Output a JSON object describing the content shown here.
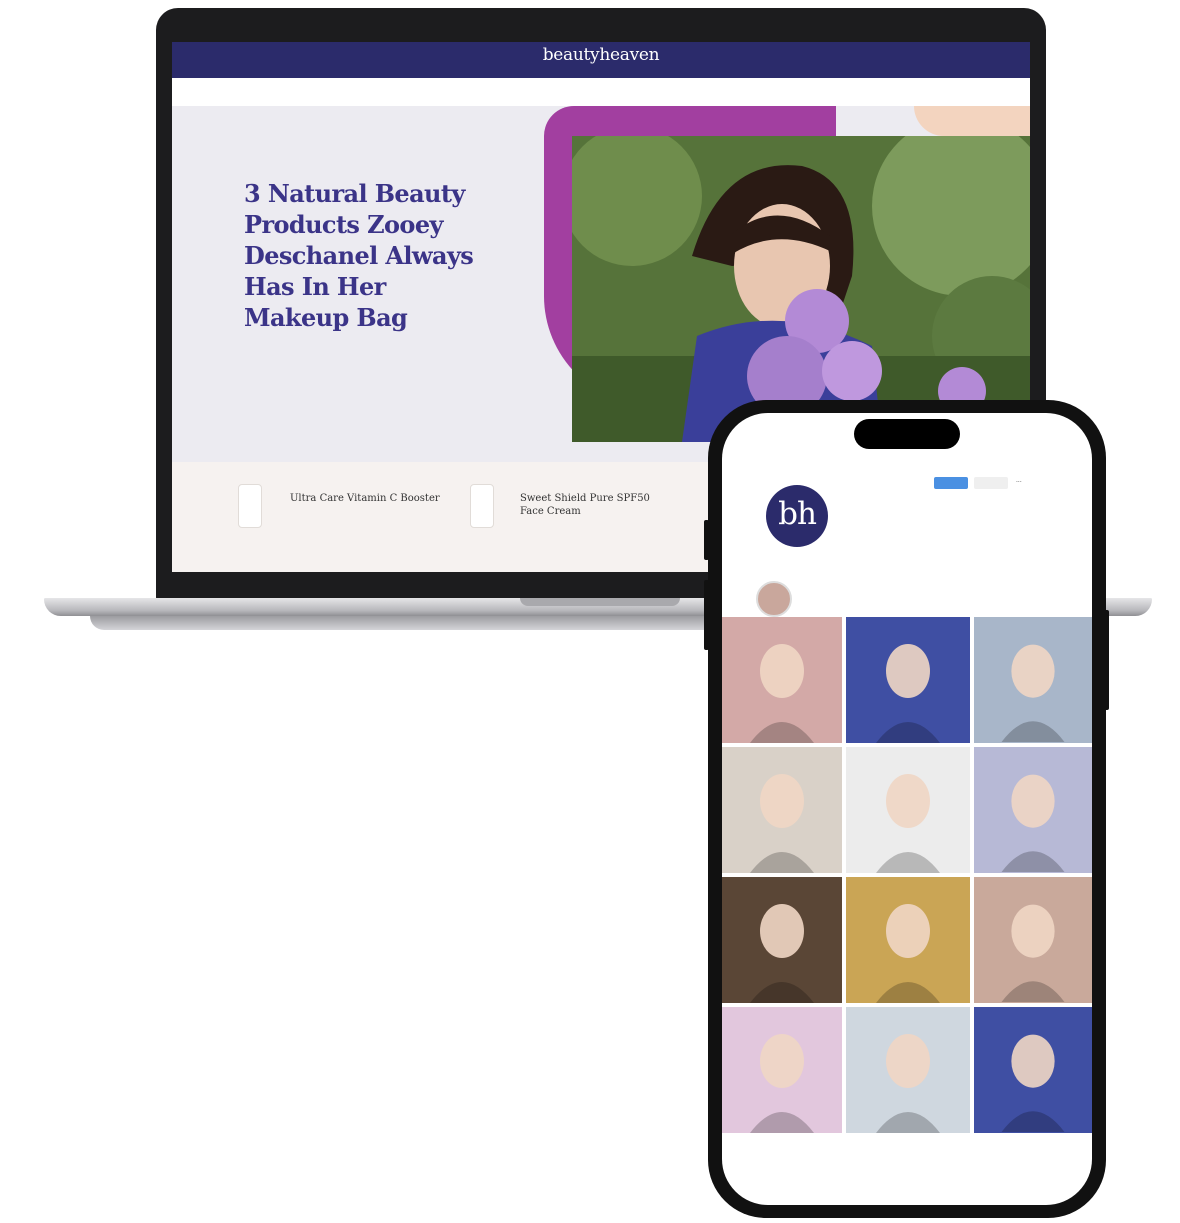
{
  "laptop": {
    "site": {
      "logo": "beautyheaven",
      "header_links": [
        "",
        "",
        ""
      ],
      "nav_items": [
        "",
        "",
        "",
        "",
        "",
        "",
        "",
        "",
        ""
      ]
    },
    "article": {
      "title": "3 Natural Beauty Products Zooey Deschanel Always Has In Her Makeup Bag",
      "byline": "",
      "summary": ""
    },
    "products": [
      {
        "category": "",
        "name": "Ultra Care Vitamin C Booster"
      },
      {
        "category": "",
        "name": "Sweet Shield Pure SPF50 Face Cream"
      }
    ]
  },
  "phone": {
    "profile": {
      "avatar_text": "bh",
      "username": "",
      "follow_label": "",
      "message_label": "",
      "more_label": "...",
      "stats": [
        "",
        "",
        ""
      ]
    },
    "grid_tiles": [
      {
        "name": "woman-pink-top",
        "color": "#d3a9a7"
      },
      {
        "name": "promo-red-dress",
        "color": "#3f4fa3"
      },
      {
        "name": "two-blondes",
        "color": "#a8b6c9"
      },
      {
        "name": "red-hair-portrait",
        "color": "#d9d1c8"
      },
      {
        "name": "black-accessories",
        "color": "#ececec"
      },
      {
        "name": "blue-nails",
        "color": "#b7b9d6"
      },
      {
        "name": "film-still",
        "color": "#5a4636"
      },
      {
        "name": "blonde-curtains",
        "color": "#caa555"
      },
      {
        "name": "glam-portraits",
        "color": "#c9a99b"
      },
      {
        "name": "pastel-poster",
        "color": "#e2c7dd"
      },
      {
        "name": "cat-on-bed",
        "color": "#cfd7df"
      },
      {
        "name": "purple-promo",
        "color": "#3f4fa3"
      }
    ]
  }
}
